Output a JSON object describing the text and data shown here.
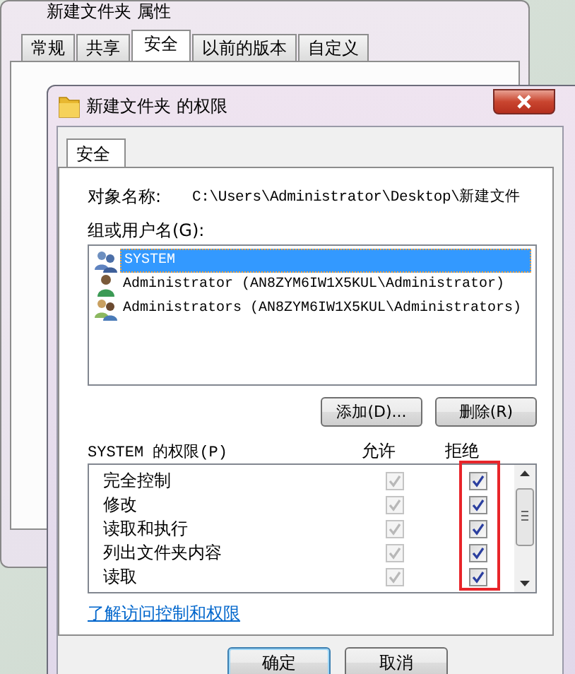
{
  "back_window": {
    "title": "新建文件夹 属性",
    "tabs": [
      {
        "label": "常规",
        "selected": false
      },
      {
        "label": "共享",
        "selected": false
      },
      {
        "label": "安全",
        "selected": true
      },
      {
        "label": "以前的版本",
        "selected": false
      },
      {
        "label": "自定义",
        "selected": false
      }
    ]
  },
  "dialog": {
    "title": "新建文件夹 的权限",
    "tabs": [
      {
        "label": "安全",
        "selected": true
      }
    ],
    "object_name_label": "对象名称:",
    "object_name": "C:\\Users\\Administrator\\Desktop\\新建文件",
    "group_label": "组或用户名(G):",
    "principals": [
      {
        "kind": "system",
        "name": "SYSTEM",
        "selected": true
      },
      {
        "kind": "user",
        "name": "Administrator (AN8ZYM6IW1X5KUL\\Administrator)",
        "selected": false
      },
      {
        "kind": "group",
        "name": "Administrators (AN8ZYM6IW1X5KUL\\Administrators)",
        "selected": false
      }
    ],
    "list_buttons": [
      "添加(D)...",
      "删除(R)"
    ],
    "permissions_label": "SYSTEM 的权限(P)",
    "allow_header": "允许",
    "deny_header": "拒绝",
    "permissions": [
      {
        "name": "完全控制",
        "allow_checked": true,
        "allow_disabled": true,
        "deny_checked": true
      },
      {
        "name": "修改",
        "allow_checked": true,
        "allow_disabled": true,
        "deny_checked": true
      },
      {
        "name": "读取和执行",
        "allow_checked": true,
        "allow_disabled": true,
        "deny_checked": true
      },
      {
        "name": "列出文件夹内容",
        "allow_checked": true,
        "allow_disabled": true,
        "deny_checked": true
      },
      {
        "name": "读取",
        "allow_checked": true,
        "allow_disabled": true,
        "deny_checked": true
      }
    ],
    "help_link": "了解访问控制和权限",
    "buttons": [
      "确定",
      "取消"
    ]
  }
}
